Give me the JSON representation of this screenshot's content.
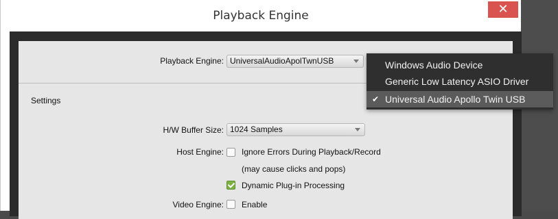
{
  "window": {
    "title": "Playback Engine",
    "close_glyph": "✕"
  },
  "playback_engine": {
    "label": "Playback Engine:",
    "value": "UniversalAudioApolTwnUSB",
    "options": [
      {
        "label": "Windows Audio Device",
        "selected": false
      },
      {
        "label": "Generic Low Latency ASIO Driver",
        "selected": false
      },
      {
        "label": "Universal Audio Apollo Twin USB",
        "selected": true
      }
    ],
    "check_glyph": "✔"
  },
  "settings": {
    "heading": "Settings",
    "hw_buffer": {
      "label": "H/W Buffer Size:",
      "value": "1024 Samples"
    },
    "host_engine": {
      "label": "Host Engine:",
      "ignore_errors": {
        "label": "Ignore Errors During Playback/Record",
        "checked": false
      },
      "ignore_errors_note": "(may cause clicks and pops)",
      "dynamic_plugin": {
        "label": "Dynamic Plug-in Processing",
        "checked": true
      }
    },
    "video_engine": {
      "label": "Video Engine:",
      "enable": {
        "label": "Enable",
        "checked": false
      }
    }
  },
  "colors": {
    "close": "#d9534f",
    "check": "#7cb342",
    "menu_bg": "#2f2f2f",
    "menu_selected": "#5b5b5b"
  }
}
